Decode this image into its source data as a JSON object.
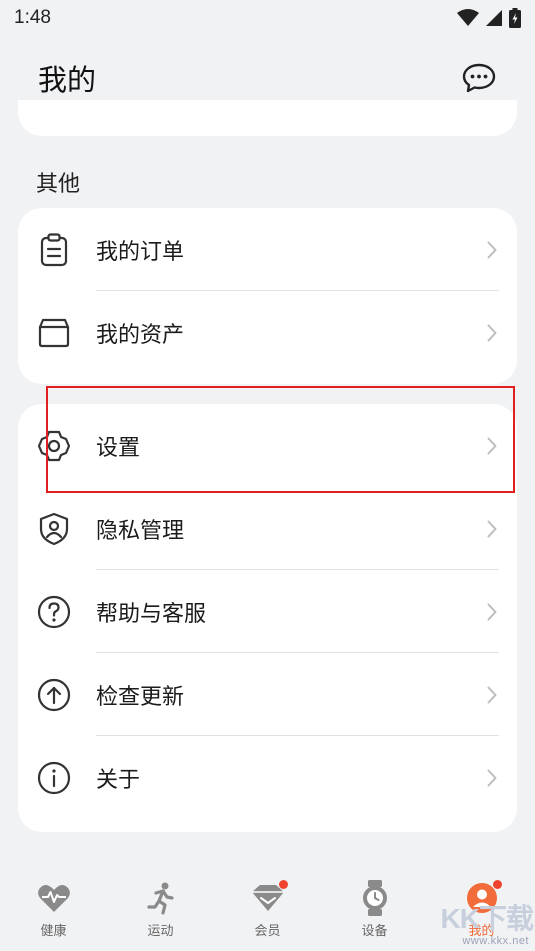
{
  "status_bar": {
    "time": "1:48"
  },
  "header": {
    "title": "我的",
    "message_icon": "chat-bubble-icon"
  },
  "section": {
    "other_label": "其他"
  },
  "card1": {
    "items": [
      {
        "label": "我的订单",
        "icon": "clipboard-icon"
      },
      {
        "label": "我的资产",
        "icon": "box-icon"
      }
    ]
  },
  "card2": {
    "items": [
      {
        "label": "设置",
        "icon": "gear-icon"
      },
      {
        "label": "隐私管理",
        "icon": "shield-user-icon"
      },
      {
        "label": "帮助与客服",
        "icon": "question-circle-icon"
      },
      {
        "label": "检查更新",
        "icon": "arrow-up-circle-icon"
      },
      {
        "label": "关于",
        "icon": "info-circle-icon"
      }
    ]
  },
  "highlight": {
    "color": "#e02020",
    "target": "设置"
  },
  "tabbar": {
    "tabs": [
      {
        "label": "健康",
        "icon": "heart-pulse-icon",
        "active": false,
        "badge": false
      },
      {
        "label": "运动",
        "icon": "running-icon",
        "active": false,
        "badge": false
      },
      {
        "label": "会员",
        "icon": "diamond-icon",
        "active": false,
        "badge": true
      },
      {
        "label": "设备",
        "icon": "watch-icon",
        "active": false,
        "badge": false
      },
      {
        "label": "我的",
        "icon": "avatar-icon",
        "active": true,
        "badge": true
      }
    ]
  },
  "watermark": {
    "logo": "KK下载",
    "url": "www.kkx.net"
  },
  "colors": {
    "accent": "#f26b3a",
    "badge": "#f0432f",
    "background": "#f1f2f4",
    "card": "#ffffff"
  }
}
